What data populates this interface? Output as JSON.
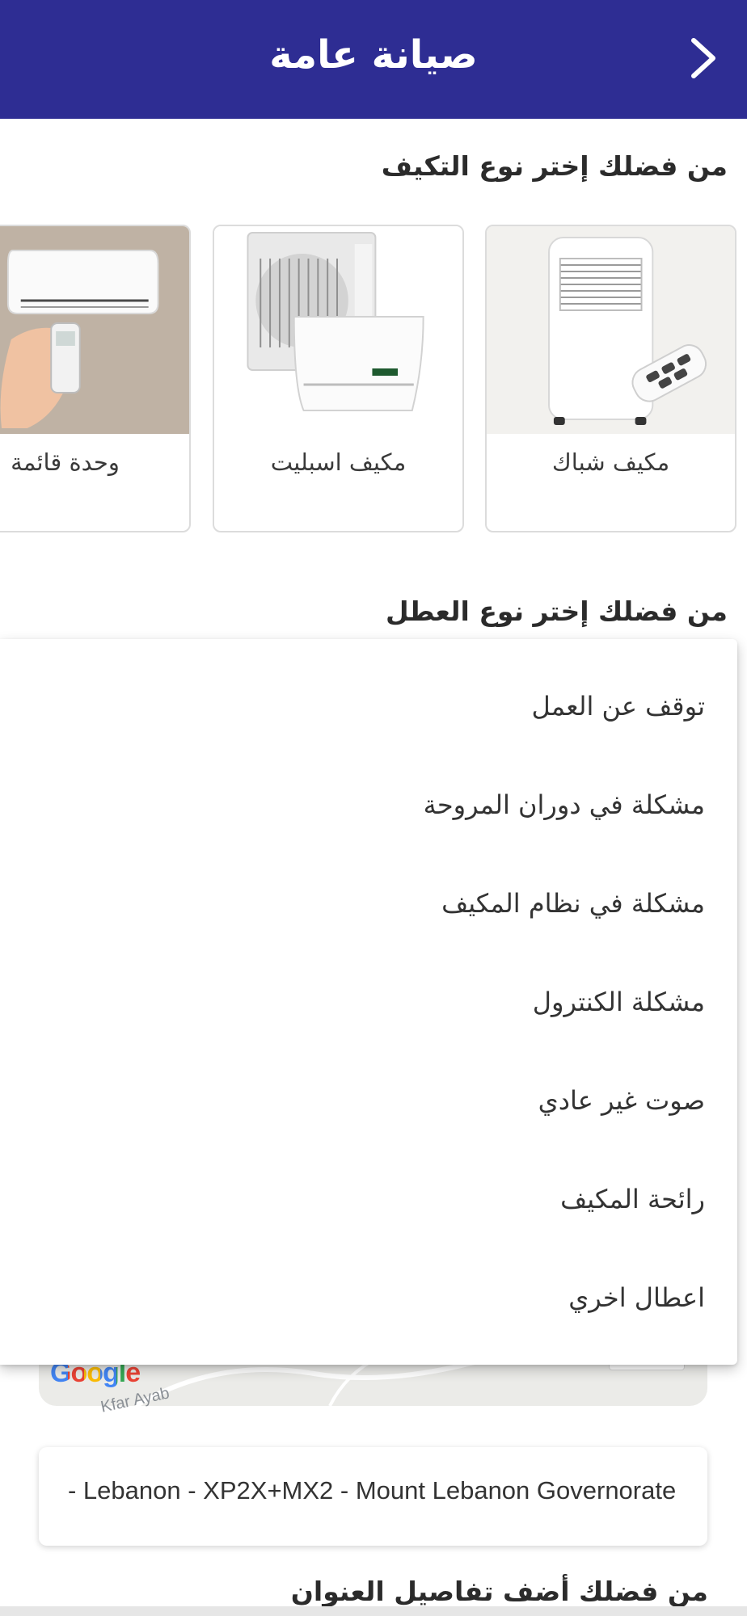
{
  "header": {
    "title": "صيانة عامة",
    "background_color": "#2e2d93"
  },
  "ac_section": {
    "title": "من فضلك إختر نوع التكيف",
    "cards": [
      {
        "label": "مكيف شباك",
        "icon": "portable-ac-image"
      },
      {
        "label": "مكيف اسبليت",
        "icon": "split-ac-image"
      },
      {
        "label": "وحدة قائمة",
        "icon": "wall-ac-remote-image"
      }
    ]
  },
  "fault_section": {
    "title": "من فضلك إختر نوع العطل",
    "options": [
      "توقف عن العمل",
      "مشكلة في دوران المروحة",
      "مشكلة في نظام المكيف",
      "مشكلة الكنترول",
      "صوت غير عادي",
      "رائحة المكيف",
      "اعطال اخري"
    ]
  },
  "map": {
    "logo": "Google",
    "place_label": "Kfar Ayab"
  },
  "address": {
    "value": "- Lebanon - XP2X+MX2 - Mount Lebanon Governorate"
  },
  "details_section": {
    "title": "من فضلك أضف تفاصيل العنوان"
  }
}
